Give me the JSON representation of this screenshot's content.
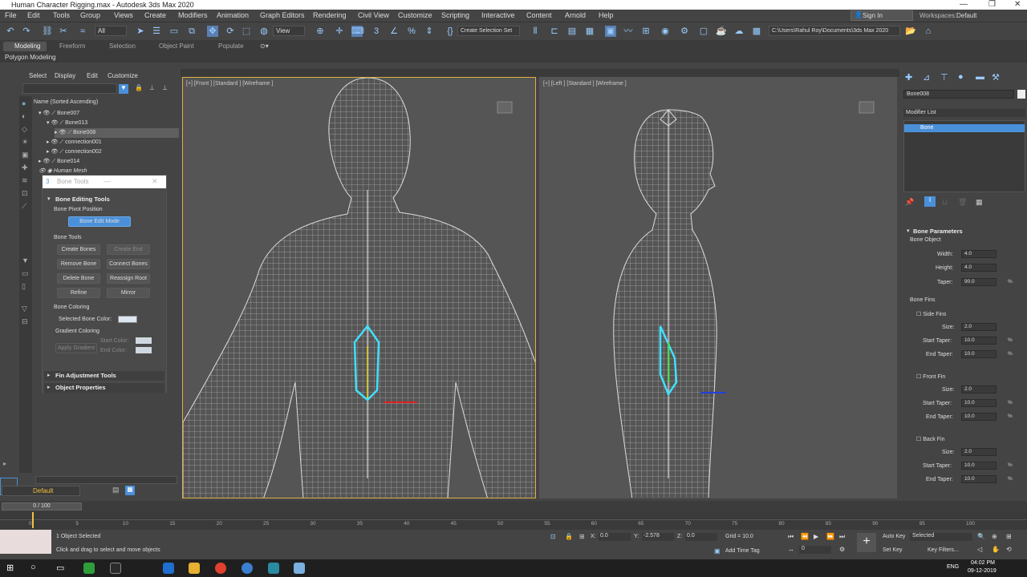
{
  "app": {
    "title": "Human Character Rigging.max - Autodesk 3ds Max 2020",
    "window_controls": [
      "—",
      "❐",
      "✕"
    ]
  },
  "menu": [
    "File",
    "Edit",
    "Tools",
    "Group",
    "Views",
    "Create",
    "Modifiers",
    "Animation",
    "Graph Editors",
    "Rendering",
    "Civil View",
    "Customize",
    "Scripting",
    "Interactive",
    "Content",
    "Arnold",
    "Help"
  ],
  "account": {
    "sign_in": "Sign In",
    "workspaces_label": "Workspaces:",
    "workspace": "Default"
  },
  "toolbar": {
    "filter_all": "All",
    "view_dropdown": "View",
    "selection_set": "Create Selection Set",
    "path": "C:\\Users\\Rahul Roy\\Documents\\3ds Max 2020"
  },
  "ribbon": {
    "tabs": [
      "Modeling",
      "Freeform",
      "Selection",
      "Object Paint",
      "Populate"
    ],
    "active_tab": "Modeling",
    "sub": "Polygon Modeling"
  },
  "scene_explorer": {
    "menu": [
      "Select",
      "Display",
      "Edit",
      "Customize"
    ],
    "header": "Name (Sorted Ascending)",
    "items": [
      {
        "name": "Bone007",
        "indent": 0
      },
      {
        "name": "Bone013",
        "indent": 1
      },
      {
        "name": "Bone008",
        "indent": 2,
        "selected": true
      },
      {
        "name": "connection001",
        "indent": 1
      },
      {
        "name": "connection002",
        "indent": 1
      },
      {
        "name": "Bone014",
        "indent": 0
      },
      {
        "name": "Human Mesh",
        "indent": 0
      }
    ],
    "layer": "Default"
  },
  "bone_tools": {
    "title": "Bone Tools",
    "section": "Bone Editing Tools",
    "pivot_group": "Bone Pivot Position",
    "edit_mode_btn": "Bone Edit Mode",
    "tools_group": "Bone Tools",
    "buttons": [
      "Create Bones",
      "Create End",
      "Remove Bone",
      "Connect Bones",
      "Delete Bone",
      "Reassign Root",
      "Refine",
      "Mirror"
    ],
    "coloring_group": "Bone Coloring",
    "selected_color_label": "Selected Bone Color:",
    "gradient_label": "Gradient Coloring",
    "apply_gradient": "Apply Gradient",
    "start_color": "Start Color:",
    "end_color": "End Color:",
    "fin_rollout": "Fin Adjustment Tools",
    "props_rollout": "Object Properties"
  },
  "viewports": {
    "front": "[+] [Front ] [Standard ] [Wireframe ]",
    "left": "[+] [Left ] [Standard ] [Wireframe ]"
  },
  "command_panel": {
    "object_name": "Bone008",
    "modifier_list": "Modifier List",
    "stack_item": "Bone",
    "rollout": "Bone Parameters",
    "bone_object": "Bone Object",
    "width_label": "Width:",
    "width": "4.0",
    "height_label": "Height:",
    "height": "4.0",
    "taper_label": "Taper:",
    "taper": "90.0",
    "fins_label": "Bone Fins",
    "fins": [
      {
        "name": "Side Fins",
        "size": "2.0",
        "start_taper": "10.0",
        "end_taper": "10.0"
      },
      {
        "name": "Front Fin",
        "size": "2.0",
        "start_taper": "10.0",
        "end_taper": "10.0"
      },
      {
        "name": "Back Fin",
        "size": "2.0",
        "start_taper": "10.0",
        "end_taper": "10.0"
      }
    ],
    "size_label": "Size:",
    "start_taper_label": "Start Taper:",
    "end_taper_label": "End Taper:",
    "pct": "%"
  },
  "timeline": {
    "frame": "0 / 100",
    "ticks": [
      "0",
      "5",
      "10",
      "15",
      "20",
      "25",
      "30",
      "35",
      "40",
      "45",
      "50",
      "55",
      "60",
      "65",
      "70",
      "75",
      "80",
      "85",
      "90",
      "95",
      "100"
    ]
  },
  "status": {
    "selected": "1 Object Selected",
    "hint": "Click and drag to select and move objects",
    "x_label": "X:",
    "x": "0.0",
    "y_label": "Y:",
    "y": "-2.578",
    "z_label": "Z:",
    "z": "0.0",
    "grid": "Grid = 10.0",
    "add_time_tag": "Add Time Tag",
    "auto_key": "Auto Key",
    "set_key": "Set Key",
    "selected_dd": "Selected",
    "key_filters": "Key Filters...",
    "frame_field": "0"
  },
  "taskbar": {
    "lang": "ENG",
    "time": "04:02 PM",
    "date": "09-12-2019"
  },
  "colors": {
    "accent": "#4a90d9",
    "bone": "#33e0ff",
    "bg": "#444444"
  }
}
